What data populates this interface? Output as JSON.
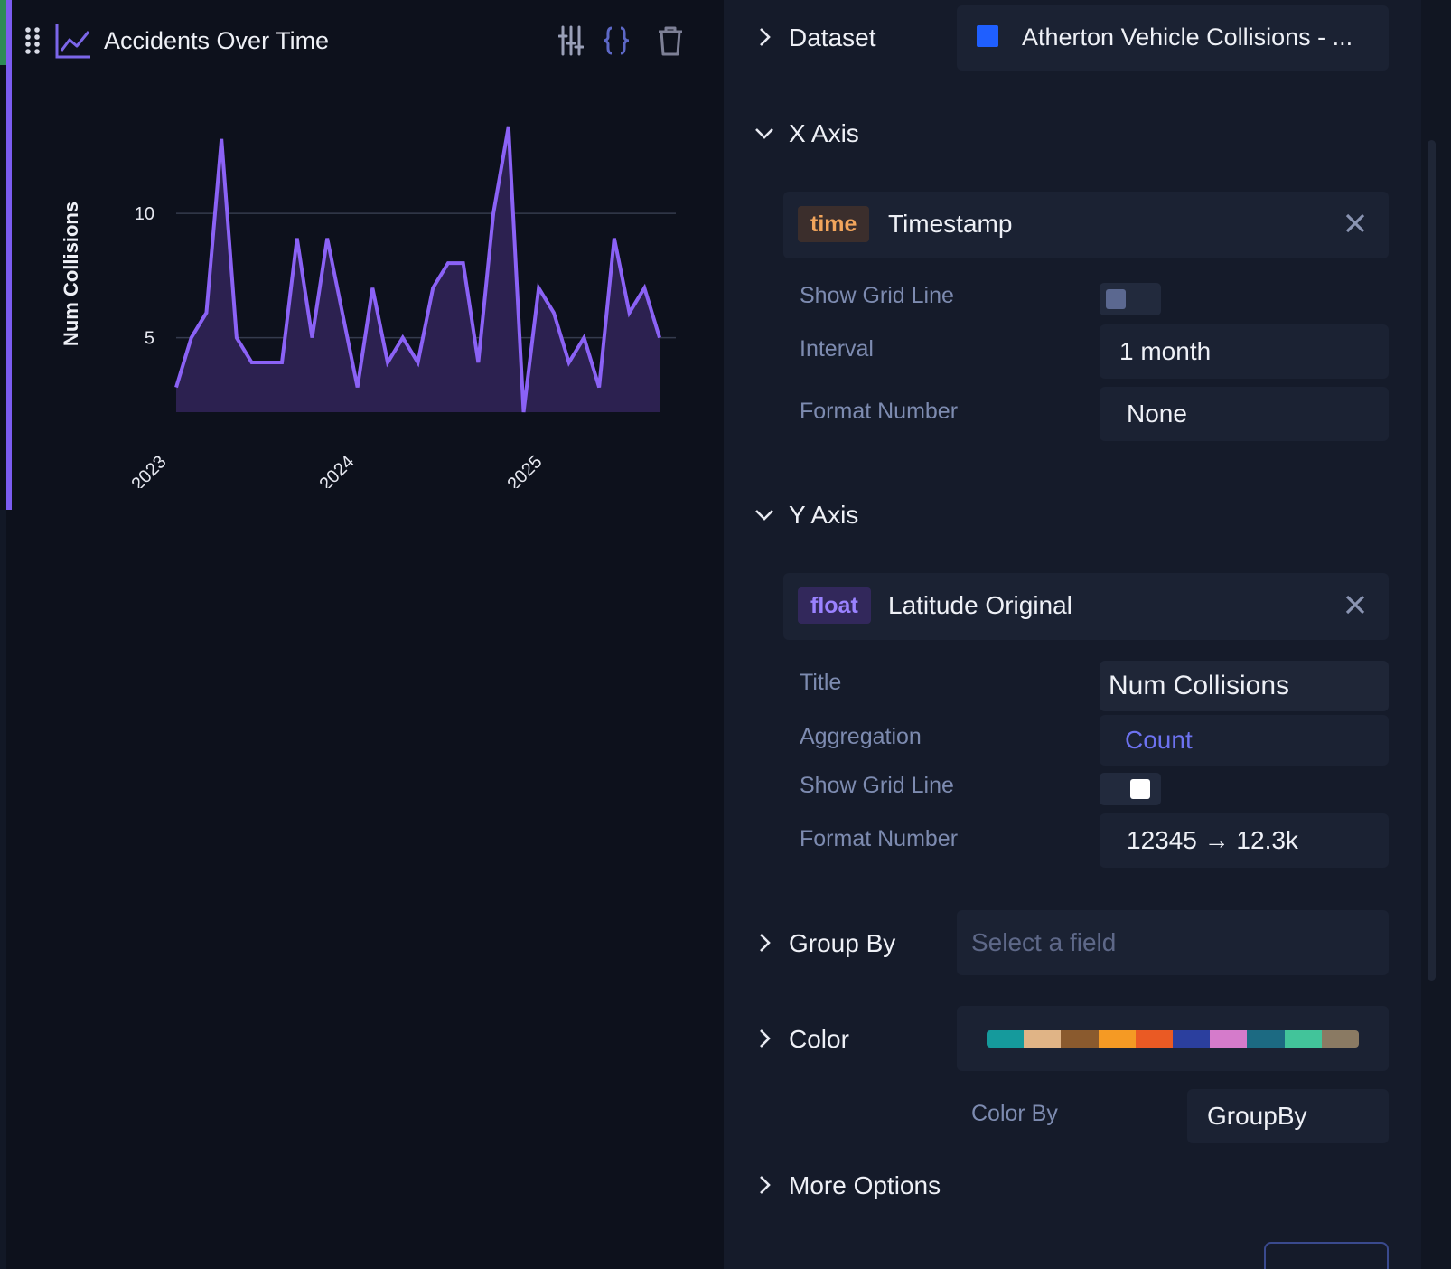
{
  "widget": {
    "title": "Accidents Over Time",
    "icons": {
      "drag": "drag-handle-icon",
      "chart_type": "line-chart-icon",
      "settings": "sliders-icon",
      "code": "braces-icon",
      "delete": "trash-icon"
    }
  },
  "chart_data": {
    "type": "area",
    "title": "",
    "xlabel": "",
    "ylabel": "Num Collisions",
    "x_tick_labels": [
      "2023",
      "2024",
      "2025"
    ],
    "y_tick_labels": [
      "5",
      "10"
    ],
    "ylim": [
      2,
      13.5
    ],
    "grid_y": true,
    "grid_x": false,
    "colors": {
      "line": "#8b62f6",
      "fill": "#2c2150",
      "grid": "#343b4d"
    },
    "series": [
      {
        "values": [
          3,
          5,
          6,
          13,
          5,
          4,
          4,
          4,
          9,
          5,
          9,
          6,
          3,
          7,
          4,
          5,
          4,
          7,
          8,
          8,
          4,
          10,
          13.5,
          2,
          7,
          6,
          4,
          5,
          3,
          9,
          6,
          7,
          5
        ]
      }
    ]
  },
  "panel": {
    "dataset": {
      "label": "Dataset",
      "value": "Atherton Vehicle Collisions - ...",
      "swatch_color": "#1f5fff"
    },
    "x_axis": {
      "label": "X Axis",
      "field_type": "time",
      "field_name": "Timestamp",
      "show_grid_label": "Show Grid Line",
      "show_grid": false,
      "interval_label": "Interval",
      "interval_value": "1 month",
      "format_label": "Format Number",
      "format_value": "None"
    },
    "y_axis": {
      "label": "Y Axis",
      "field_type": "float",
      "field_name": "Latitude Original",
      "title_label": "Title",
      "title_value": "Num Collisions",
      "aggregation_label": "Aggregation",
      "aggregation_value": "Count",
      "show_grid_label": "Show Grid Line",
      "show_grid": true,
      "format_label": "Format Number",
      "format_value": "12345 → 12.3k"
    },
    "group_by": {
      "label": "Group By",
      "placeholder": "Select a field"
    },
    "color": {
      "label": "Color",
      "palette": [
        "#159a9c",
        "#e0b486",
        "#8a5a2e",
        "#f59a24",
        "#ea5a24",
        "#2b3f9e",
        "#d57bcb",
        "#1c6a82",
        "#42c49a",
        "#8a7a63"
      ],
      "color_by_label": "Color By",
      "color_by_value": "GroupBy"
    },
    "more_options": {
      "label": "More Options"
    }
  }
}
